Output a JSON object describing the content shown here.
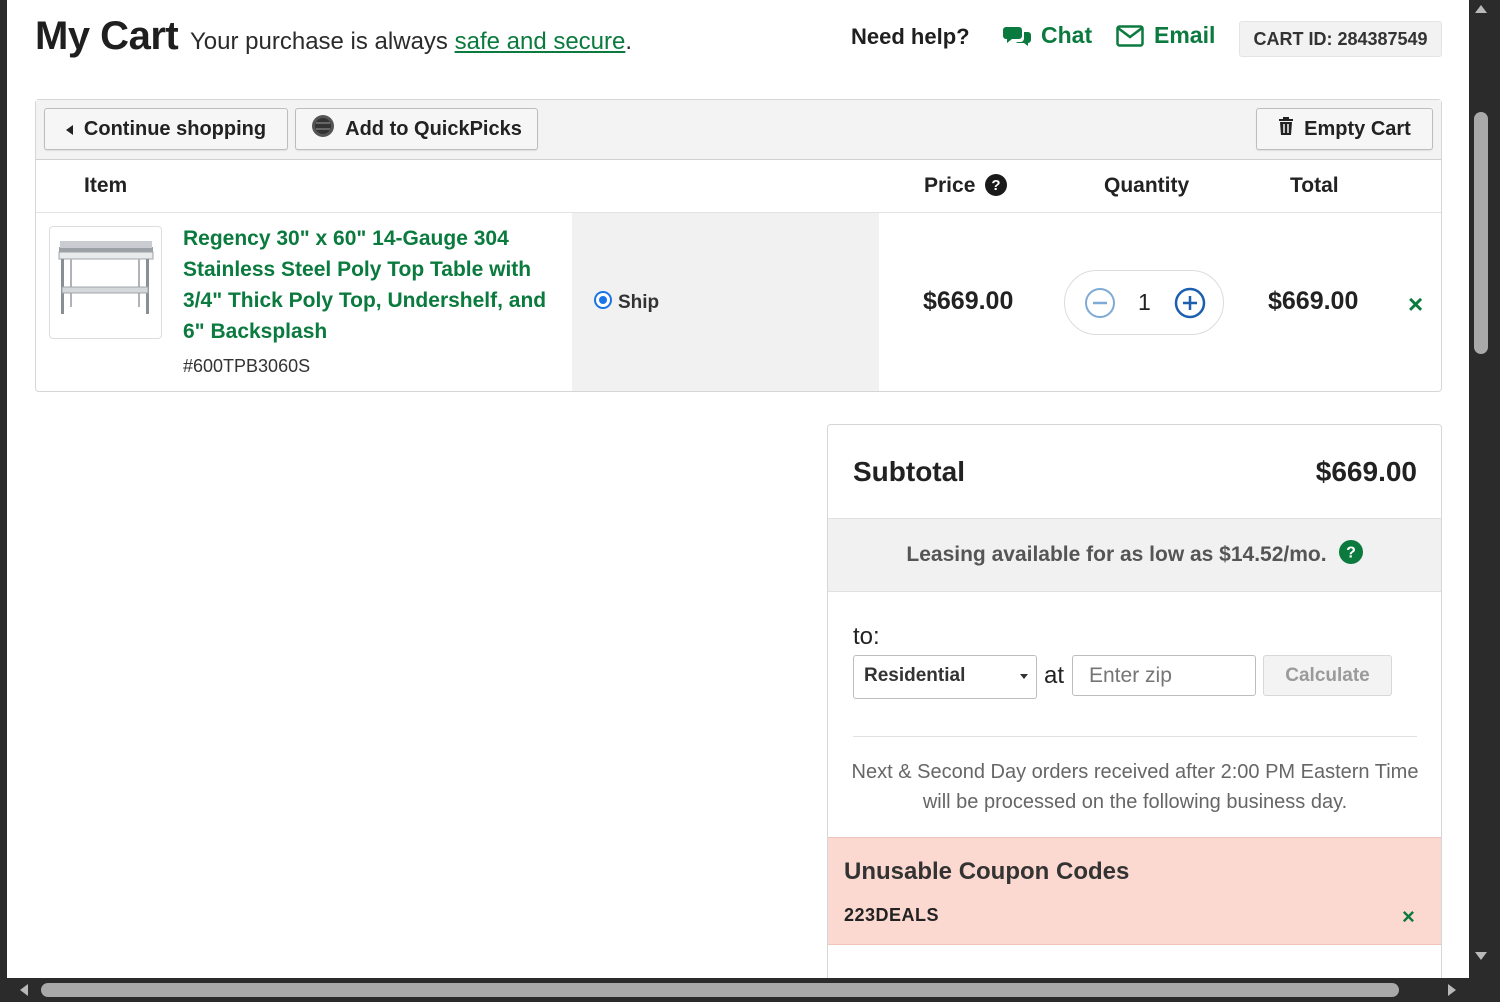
{
  "header": {
    "title": "My Cart",
    "tagline_prefix": "Your purchase is always ",
    "tagline_link": "safe and secure",
    "tagline_suffix": ".",
    "help_label": "Need help?",
    "chat_label": "Chat",
    "email_label": "Email",
    "cart_id": "CART ID: 284387549"
  },
  "toolbar": {
    "continue_label": "Continue shopping",
    "quickpicks_label": "Add to QuickPicks",
    "empty_label": "Empty Cart"
  },
  "table": {
    "headers": {
      "item": "Item",
      "price": "Price",
      "quantity": "Quantity",
      "total": "Total"
    },
    "items": [
      {
        "name": "Regency 30\" x 60\" 14-Gauge 304 Stainless Steel Poly Top Table with 3/4\" Thick Poly Top, Undershelf, and 6\" Backsplash",
        "sku": "#600TPB3060S",
        "fulfillment": "Ship",
        "price": "$669.00",
        "quantity": "1",
        "total": "$669.00",
        "remove": "×"
      }
    ]
  },
  "summary": {
    "subtotal_label": "Subtotal",
    "subtotal_value": "$669.00",
    "leasing_text": "Leasing available for as low as $14.52/mo.",
    "to_label": "to:",
    "address_type": "Residential",
    "at_label": "at",
    "zip_placeholder": "Enter zip",
    "calculate_label": "Calculate",
    "note": "Next & Second Day orders received after 2:00 PM Eastern Time will be processed on the following business day.",
    "coupon_title": "Unusable Coupon Codes",
    "coupon_code": "223DEALS",
    "coupon_remove": "×"
  },
  "colors": {
    "accent_green": "#0b7a3e",
    "radio_blue": "#1a73e8",
    "coupon_bg": "#fbd8d0"
  }
}
